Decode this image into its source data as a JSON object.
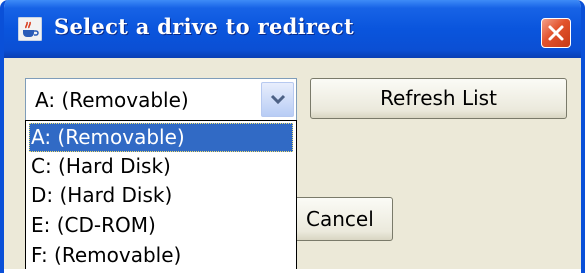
{
  "window": {
    "title": "Select a drive to redirect",
    "close_label": "close"
  },
  "drive_combo": {
    "selected_value": "A: (Removable)"
  },
  "buttons": {
    "refresh_label": "Refresh List",
    "cancel_label": "Cancel"
  },
  "dropdown": {
    "options": [
      "A: (Removable)",
      "C: (Hard Disk)",
      "D: (Hard Disk)",
      "E: (CD-ROM)",
      "F: (Removable)"
    ],
    "selected_index": 0
  },
  "icons": {
    "app": "java-coffee-cup-icon",
    "close": "close-x-icon",
    "combo_arrow": "chevron-down-icon"
  },
  "colors": {
    "titlebar": "#0a55dd",
    "selection": "#316ac5",
    "close_button": "#e2522c",
    "dialog_background": "#ece9d8"
  }
}
